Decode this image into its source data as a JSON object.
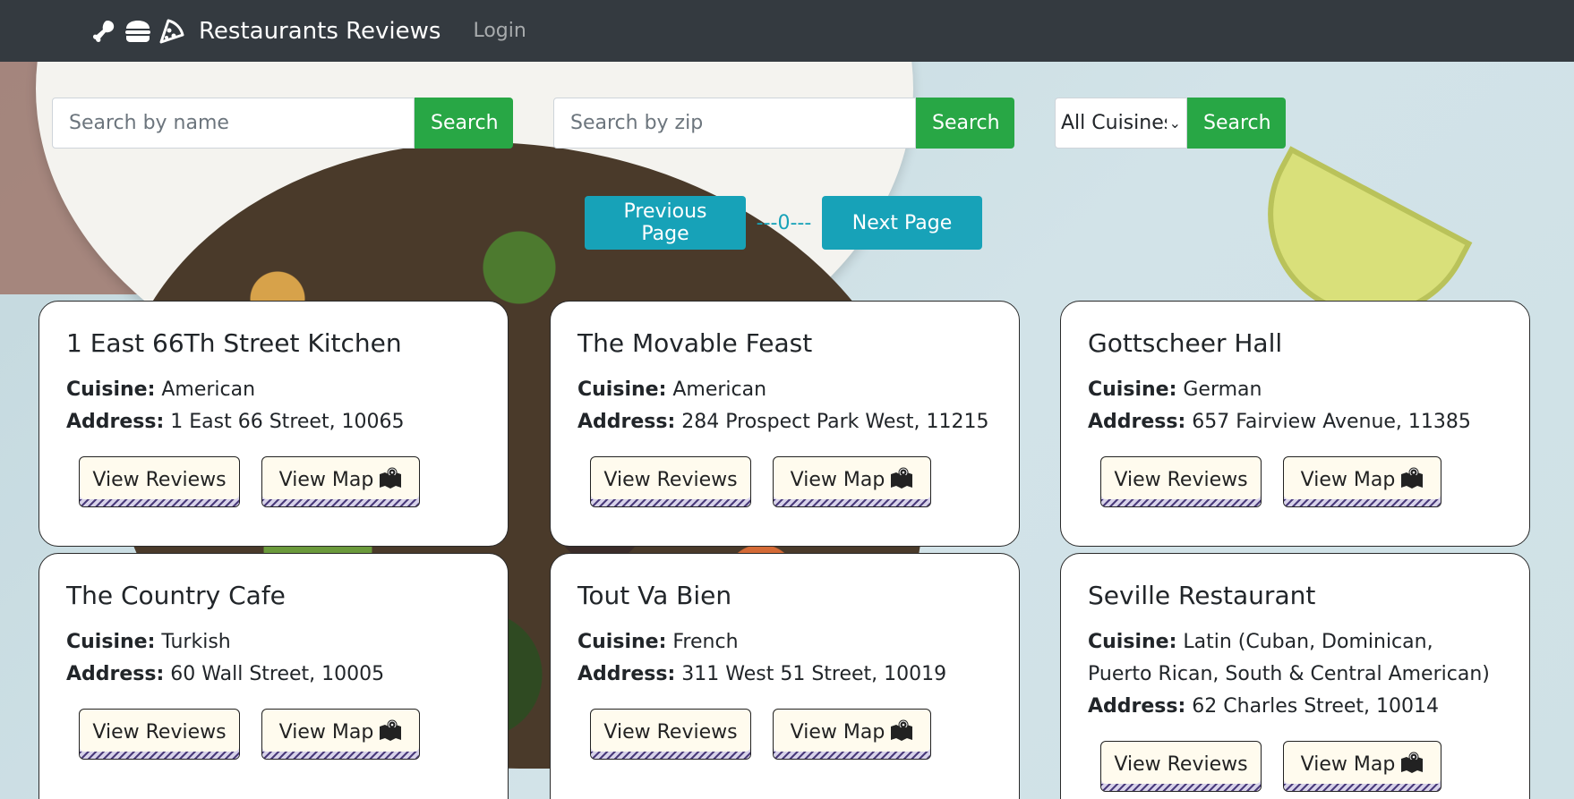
{
  "navbar": {
    "title": "Restaurants Reviews",
    "login_label": "Login",
    "icons": [
      "drumstick-icon",
      "hamburger-icon",
      "pizza-icon"
    ]
  },
  "search": {
    "name_placeholder": "Search by name",
    "zip_placeholder": "Search by zip",
    "cuisine_selected": "All Cuisines",
    "button_label": "Search"
  },
  "pagination": {
    "prev_label": "Previous Page",
    "page_display": "---0---",
    "next_label": "Next Page"
  },
  "labels": {
    "cuisine": "Cuisine:",
    "address": "Address:",
    "view_reviews": "View Reviews",
    "view_map": "View Map"
  },
  "restaurants": [
    {
      "name": "1 East 66Th Street Kitchen",
      "cuisine": "American",
      "address": "1 East 66 Street, 10065"
    },
    {
      "name": "The Movable Feast",
      "cuisine": "American",
      "address": "284 Prospect Park West, 11215"
    },
    {
      "name": "Gottscheer Hall",
      "cuisine": "German",
      "address": "657 Fairview Avenue, 11385"
    },
    {
      "name": "The Country Cafe",
      "cuisine": "Turkish",
      "address": "60 Wall Street, 10005"
    },
    {
      "name": "Tout Va Bien",
      "cuisine": "French",
      "address": "311 West 51 Street, 10019"
    },
    {
      "name": "Seville Restaurant",
      "cuisine": "Latin (Cuban, Dominican, Puerto Rican, South & Central American)",
      "address": "62 Charles Street, 10014"
    }
  ],
  "colors": {
    "navbar": "#343a40",
    "search_button": "#28a745",
    "page_button": "#17a2b8",
    "card_button": "#fffbee"
  }
}
